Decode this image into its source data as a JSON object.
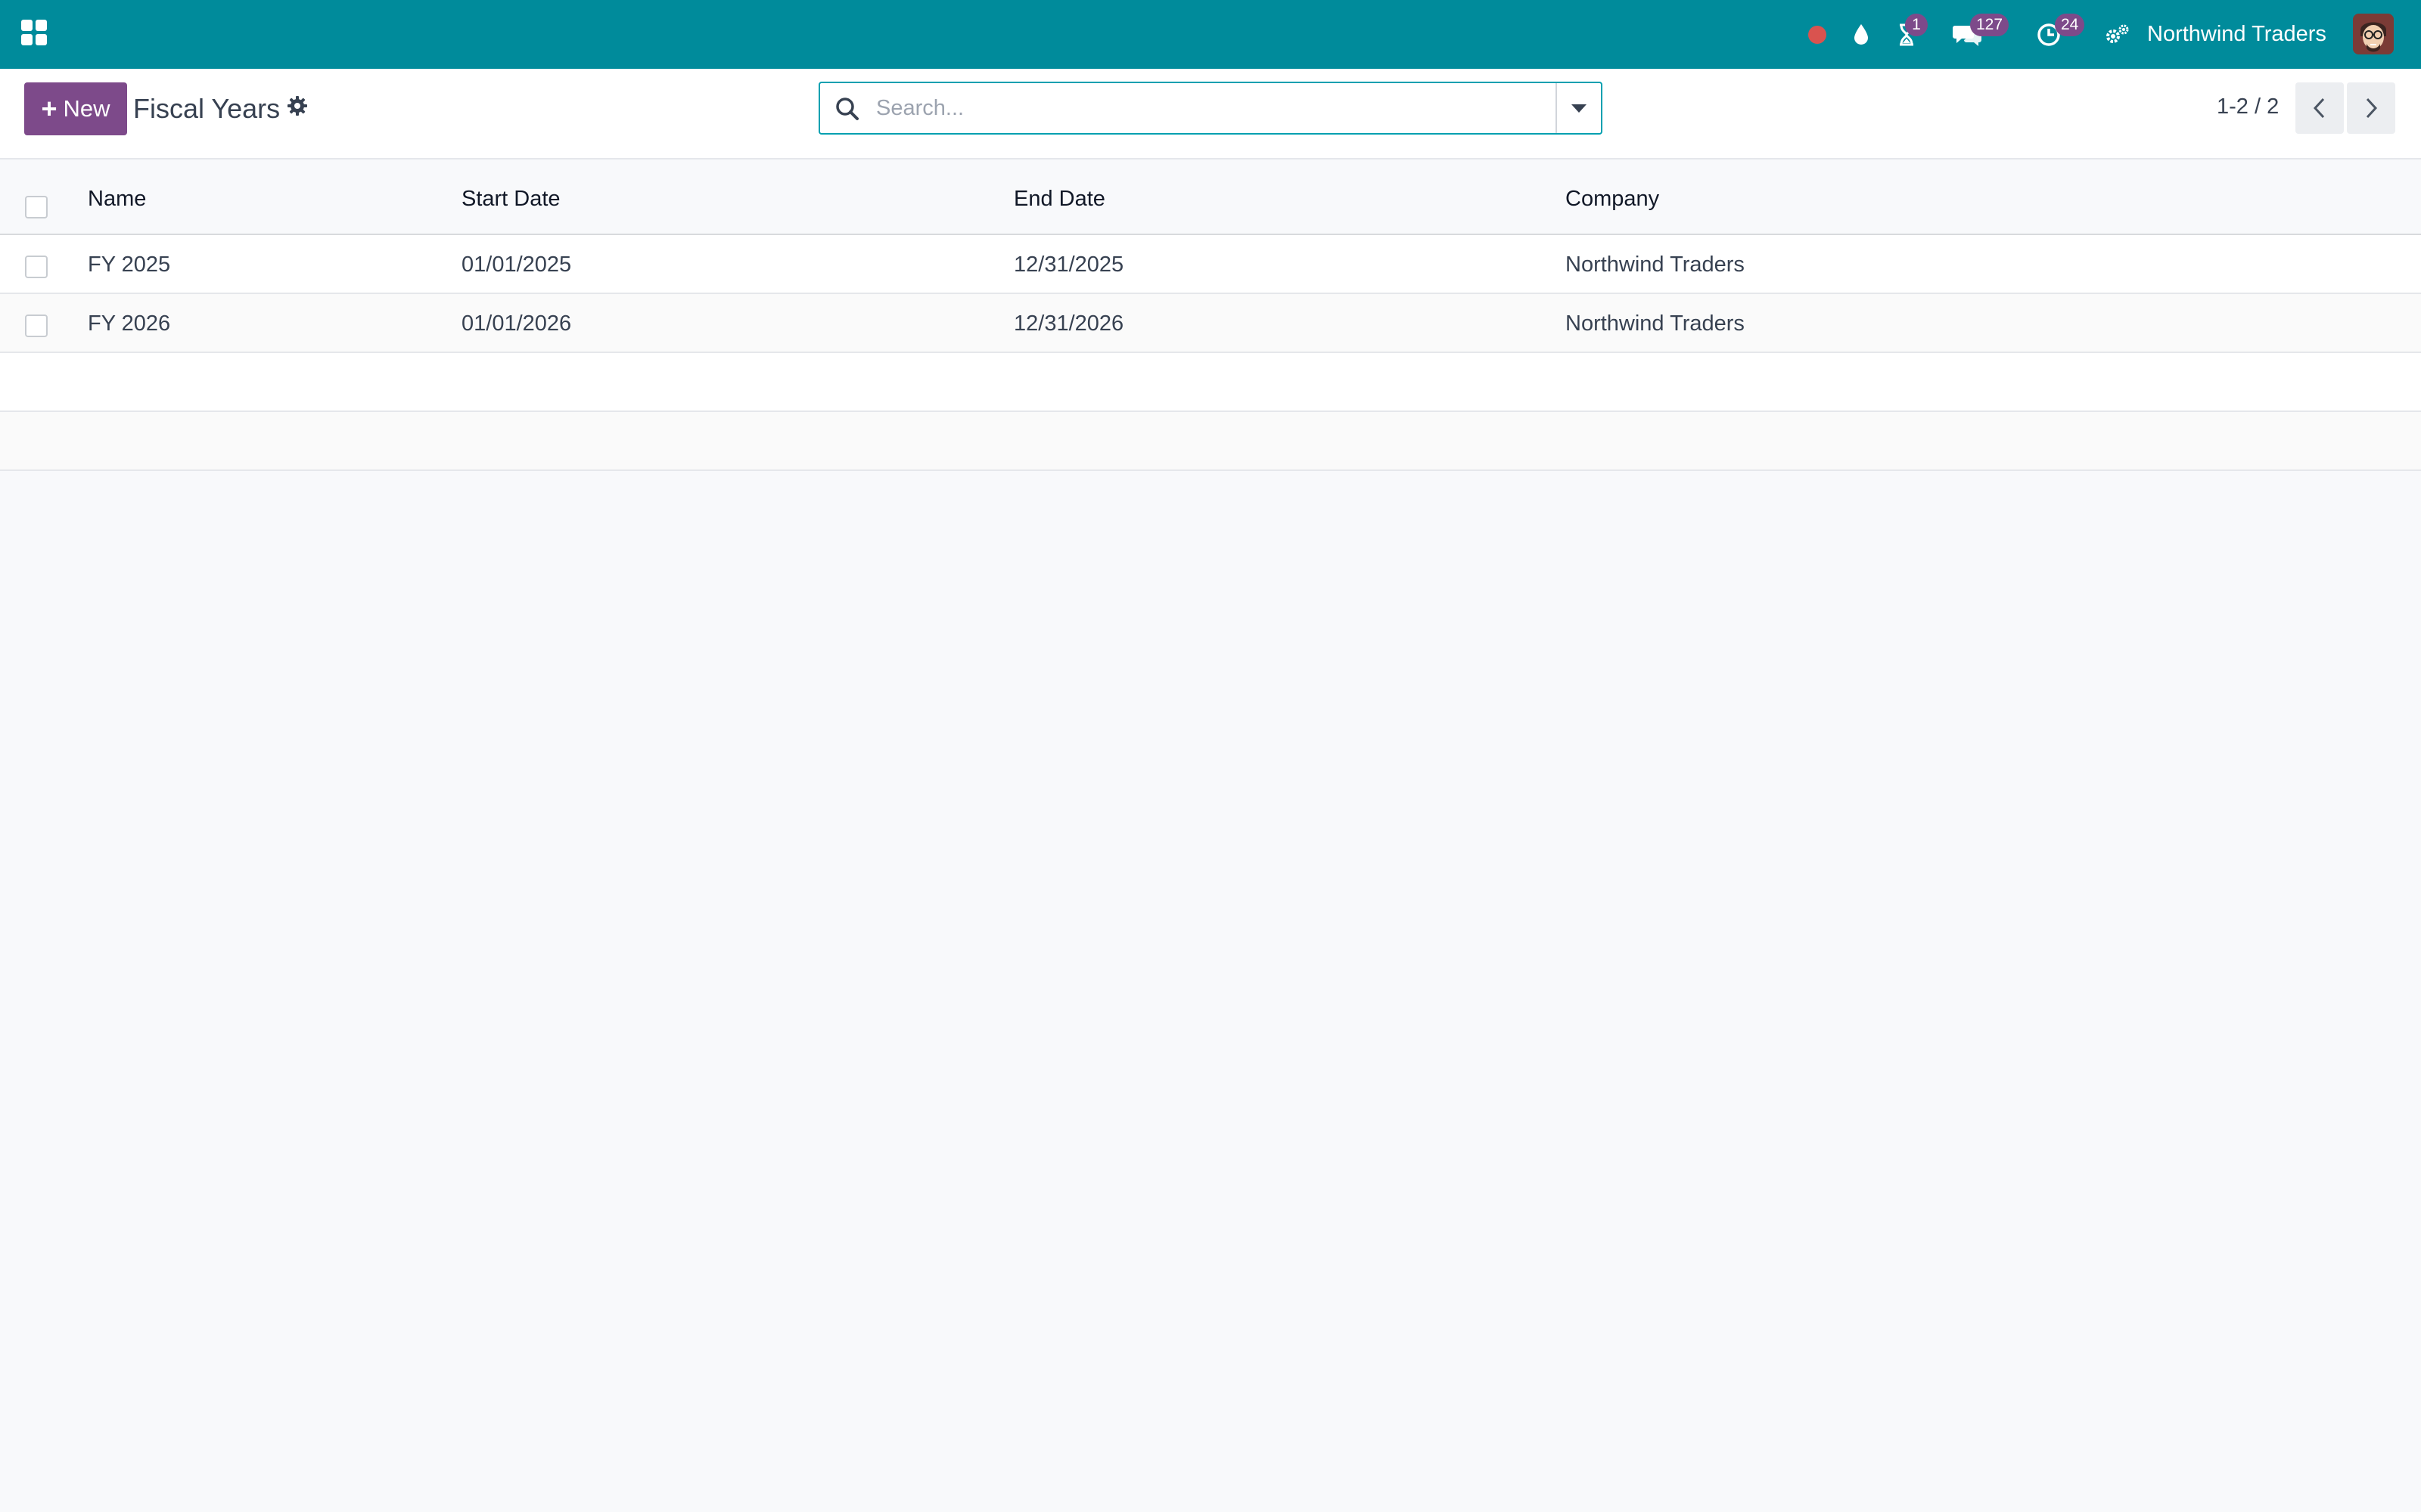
{
  "navbar": {
    "company": "Northwind Traders",
    "badges": {
      "activities": "1",
      "messages": "127",
      "timesheet": "24"
    },
    "colors": {
      "bar": "#008b9b",
      "badge": "#7d4a8a",
      "record_dot": "#d9534f"
    }
  },
  "control_panel": {
    "new_label": "New",
    "title": "Fiscal Years",
    "search_placeholder": "Search...",
    "pager": "1-2 / 2"
  },
  "list": {
    "columns": [
      "Name",
      "Start Date",
      "End Date",
      "Company"
    ],
    "rows": [
      {
        "name": "FY 2025",
        "start": "01/01/2025",
        "end": "12/31/2025",
        "company": "Northwind Traders"
      },
      {
        "name": "FY 2026",
        "start": "01/01/2026",
        "end": "12/31/2026",
        "company": "Northwind Traders"
      }
    ]
  }
}
